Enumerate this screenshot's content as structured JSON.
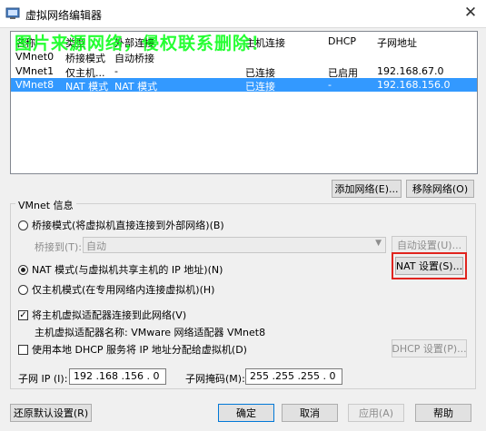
{
  "window": {
    "title": "虚拟网络编辑器",
    "close_glyph": "✕"
  },
  "watermark": "图片来源网络，侵权联系删除！",
  "network_table": {
    "columns": [
      "名称",
      "类型",
      "外部连接",
      "主机连接",
      "DHCP",
      "子网地址"
    ],
    "rows": [
      {
        "name": "VMnet0",
        "type": "桥接模式",
        "external": "自动桥接",
        "host": "",
        "dhcp": "",
        "subnet": ""
      },
      {
        "name": "VMnet1",
        "type": "仅主机...",
        "external": "-",
        "host": "已连接",
        "dhcp": "已启用",
        "subnet": "192.168.67.0"
      },
      {
        "name": "VMnet8",
        "type": "NAT 模式",
        "external": "NAT 模式",
        "host": "已连接",
        "dhcp": "-",
        "subnet": "192.168.156.0",
        "selected": true
      }
    ]
  },
  "buttons": {
    "add_network": "添加网络(E)...",
    "remove_network": "移除网络(O)",
    "auto_settings": "自动设置(U)...",
    "nat_settings": "NAT 设置(S)...",
    "dhcp_settings": "DHCP 设置(P)...",
    "restore_defaults": "还原默认设置(R)",
    "ok": "确定",
    "cancel": "取消",
    "apply": "应用(A)",
    "help": "帮助"
  },
  "vmnet_info": {
    "group_title": "VMnet 信息",
    "bridge_mode": "桥接模式(将虚拟机直接连接到外部网络)(B)",
    "bridge_to_label": "桥接到(T):",
    "bridge_to_value": "自动",
    "nat_mode": "NAT 模式(与虚拟机共享主机的 IP 地址)(N)",
    "host_only_mode": "仅主机模式(在专用网络内连接虚拟机)(H)",
    "selected_mode": "nat",
    "connect_adapter": "将主机虚拟适配器连接到此网络(V)",
    "connect_adapter_checked": true,
    "adapter_name": "主机虚拟适配器名称: VMware 网络适配器 VMnet8",
    "use_dhcp": "使用本地 DHCP 服务将 IP 地址分配给虚拟机(D)",
    "use_dhcp_checked": false,
    "subnet_ip_label": "子网 IP (I):",
    "subnet_ip": "192 .168 .156 .  0",
    "subnet_mask_label": "子网掩码(M):",
    "subnet_mask": "255 .255 .255 .  0"
  },
  "highlight_color": "#e0241e",
  "selection_color": "#3399ff"
}
